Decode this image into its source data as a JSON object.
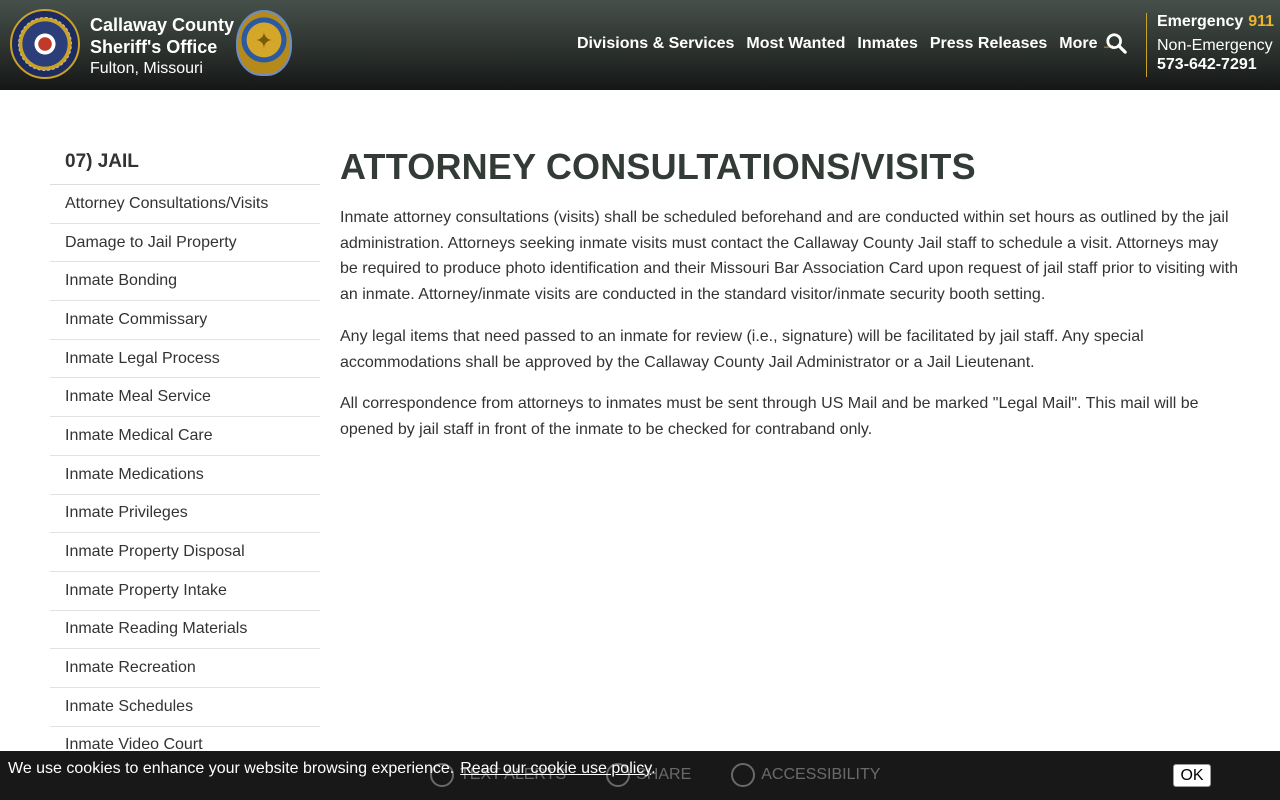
{
  "header": {
    "brand_line1": "Callaway County",
    "brand_line2": "Sheriff's Office",
    "brand_line3": "Fulton, Missouri",
    "nav": [
      "Divisions & Services",
      "Most Wanted",
      "Inmates",
      "Press Releases",
      "More"
    ],
    "emergency_label": "Emergency",
    "emergency_number": "911",
    "nonemergency_label": "Non-Emergency",
    "nonemergency_number": "573-642-7291",
    "accent_color": "#f0b429"
  },
  "sidebar": {
    "title": "07) JAIL",
    "items": [
      "Attorney Consultations/Visits",
      "Damage to Jail Property",
      "Inmate Bonding",
      "Inmate Commissary",
      "Inmate Legal Process",
      "Inmate Meal Service",
      "Inmate Medical Care",
      "Inmate Medications",
      "Inmate Privileges",
      "Inmate Property Disposal",
      "Inmate Property Intake",
      "Inmate Reading Materials",
      "Inmate Recreation",
      "Inmate Schedules",
      "Inmate Video Court"
    ]
  },
  "main": {
    "title": "ATTORNEY CONSULTATIONS/VISITS",
    "paragraphs": [
      "Inmate attorney consultations (visits) shall be scheduled beforehand and are conducted within set hours as outlined by the jail administration. Attorneys seeking inmate visits must contact the Callaway County Jail staff to schedule a visit. Attorneys may be required to produce photo identification and their Missouri Bar Association Card upon request of jail staff prior to visiting with an inmate.   Attorney/inmate visits are conducted in the standard visitor/inmate security booth setting.",
      "Any legal items that need passed to an inmate for review (i.e., signature) will be facilitated by jail staff. Any special accommodations shall be approved by the Callaway County Jail Administrator or a Jail Lieutenant.",
      "All correspondence from attorneys to inmates must be sent through US Mail and be marked \"Legal Mail\".  This mail will be opened by jail staff in front of the inmate to be checked for contraband only."
    ]
  },
  "cookie": {
    "text": "We use cookies to enhance your website browsing experience.",
    "link": "Read our cookie use policy",
    "after_link": ".",
    "ok": "OK"
  },
  "tools": {
    "alert": "TEXT ALERTS",
    "share": "SHARE",
    "accessibility": "ACCESSIBILITY"
  }
}
